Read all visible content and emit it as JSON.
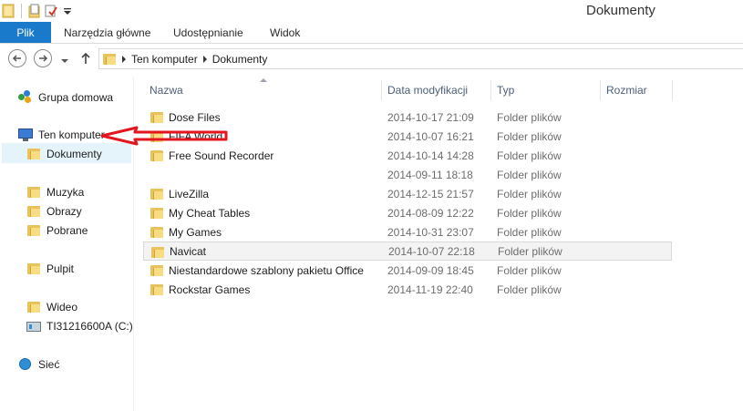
{
  "window": {
    "title": "Dokumenty"
  },
  "ribbon": {
    "tabs": [
      {
        "label": "Plik"
      },
      {
        "label": "Narzędzia główne"
      },
      {
        "label": "Udostępnianie"
      },
      {
        "label": "Widok"
      }
    ]
  },
  "address": {
    "crumbs": [
      "Ten komputer",
      "Dokumenty"
    ]
  },
  "navpane": {
    "items": [
      {
        "label": "Grupa domowa",
        "icon": "homegroup-icon"
      },
      {
        "label": "Ten komputer",
        "icon": "computer-icon"
      },
      {
        "label": "Dokumenty",
        "icon": "folder-icon"
      },
      {
        "label": "Muzyka",
        "icon": "folder-icon"
      },
      {
        "label": "Obrazy",
        "icon": "folder-icon"
      },
      {
        "label": "Pobrane",
        "icon": "folder-icon"
      },
      {
        "label": "Pulpit",
        "icon": "folder-icon"
      },
      {
        "label": "Wideo",
        "icon": "folder-icon"
      },
      {
        "label": "TI31216600A (C:)",
        "icon": "drive-icon"
      },
      {
        "label": "Sieć",
        "icon": "network-icon"
      }
    ]
  },
  "columns": {
    "name": "Nazwa",
    "date": "Data modyfikacji",
    "type": "Typ",
    "size": "Rozmiar"
  },
  "files": [
    {
      "name": "Dose Files",
      "date": "2014-10-17 21:09",
      "type": "Folder plików"
    },
    {
      "name": "FIFA World",
      "date": "2014-10-07 16:21",
      "type": "Folder plików"
    },
    {
      "name": "Free Sound Recorder",
      "date": "2014-10-14 14:28",
      "type": "Folder plików"
    },
    {
      "name": "",
      "date": "2014-09-11 18:18",
      "type": "Folder plików"
    },
    {
      "name": "LiveZilla",
      "date": "2014-12-15 21:57",
      "type": "Folder plików"
    },
    {
      "name": "My Cheat Tables",
      "date": "2014-08-09 12:22",
      "type": "Folder plików"
    },
    {
      "name": "My Games",
      "date": "2014-10-31 23:07",
      "type": "Folder plików"
    },
    {
      "name": "Navicat",
      "date": "2014-10-07 22:18",
      "type": "Folder plików"
    },
    {
      "name": "Niestandardowe szablony pakietu Office",
      "date": "2014-09-09 18:45",
      "type": "Folder plików"
    },
    {
      "name": "Rockstar Games",
      "date": "2014-11-19 22:40",
      "type": "Folder plików"
    }
  ],
  "colors": {
    "file_tab": "#1979ca",
    "selection": "#e5f3fb",
    "folder": "#f8dc82",
    "annotation": "#e3161e"
  }
}
